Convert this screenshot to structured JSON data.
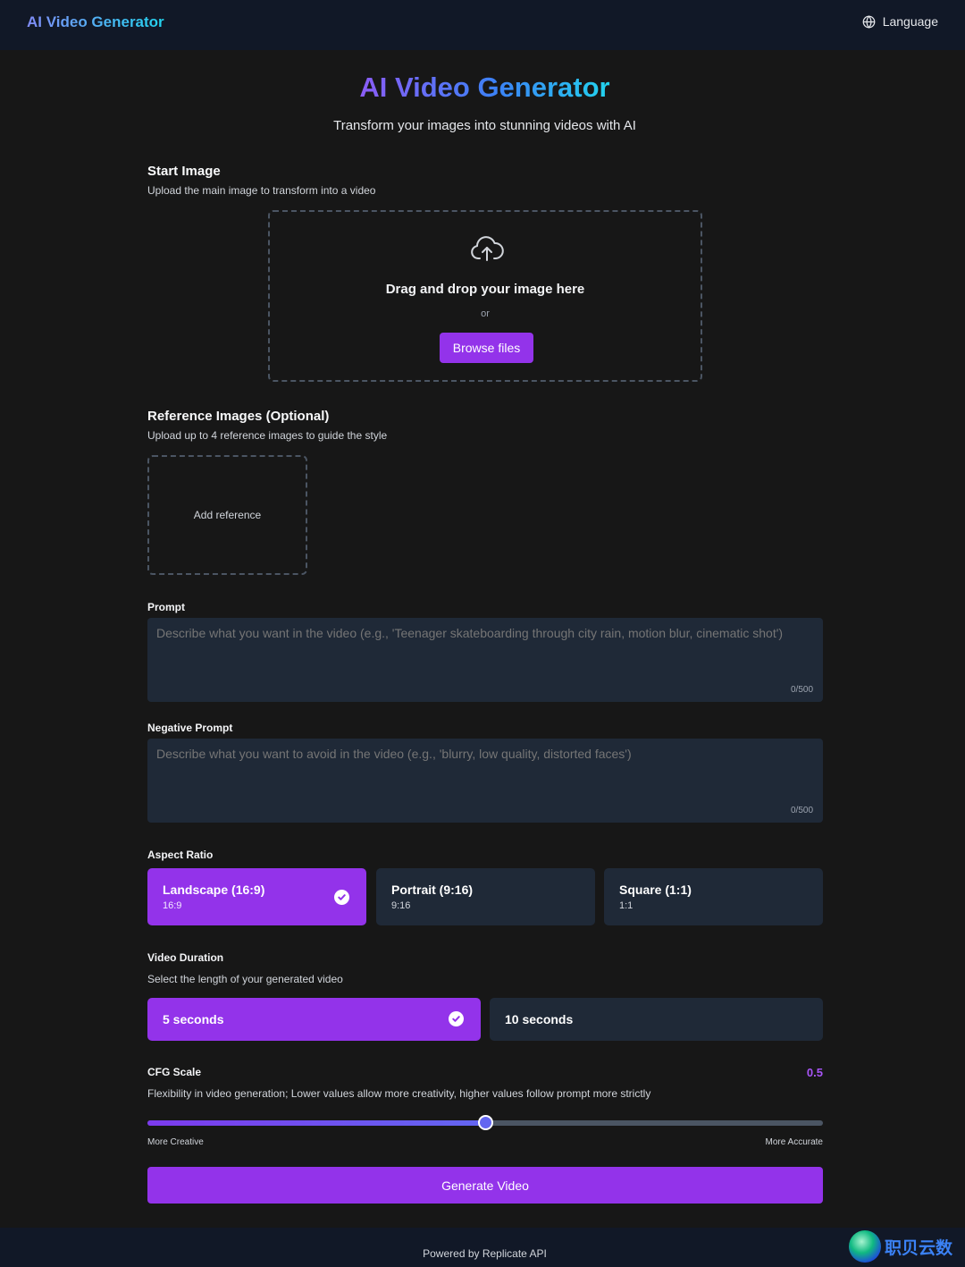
{
  "header": {
    "brand": "AI Video Generator",
    "language_label": "Language"
  },
  "hero": {
    "title": "AI Video Generator",
    "subtitle": "Transform your images into stunning videos with AI"
  },
  "start_image": {
    "title": "Start Image",
    "subtitle": "Upload the main image to transform into a video",
    "drop_text": "Drag and drop your image here",
    "or_text": "or",
    "browse_label": "Browse files"
  },
  "reference": {
    "title": "Reference Images (Optional)",
    "subtitle": "Upload up to 4 reference images to guide the style",
    "add_label": "Add reference"
  },
  "prompt": {
    "label": "Prompt",
    "placeholder": "Describe what you want in the video (e.g., 'Teenager skateboarding through city rain, motion blur, cinematic shot')",
    "counter": "0/500"
  },
  "negative_prompt": {
    "label": "Negative Prompt",
    "placeholder": "Describe what you want to avoid in the video (e.g., 'blurry, low quality, distorted faces')",
    "counter": "0/500"
  },
  "aspect_ratio": {
    "label": "Aspect Ratio",
    "options": [
      {
        "name": "Landscape (16:9)",
        "value": "16:9",
        "selected": true
      },
      {
        "name": "Portrait (9:16)",
        "value": "9:16",
        "selected": false
      },
      {
        "name": "Square (1:1)",
        "value": "1:1",
        "selected": false
      }
    ]
  },
  "duration": {
    "label": "Video Duration",
    "subtitle": "Select the length of your generated video",
    "options": [
      {
        "name": "5 seconds",
        "selected": true
      },
      {
        "name": "10 seconds",
        "selected": false
      }
    ]
  },
  "cfg": {
    "label": "CFG Scale",
    "value": "0.5",
    "level": 0.5,
    "description": "Flexibility in video generation; Lower values allow more creativity, higher values follow prompt more strictly",
    "min_label": "More Creative",
    "max_label": "More Accurate"
  },
  "generate_label": "Generate Video",
  "footer": {
    "text": "Powered by Replicate API"
  },
  "watermark": {
    "text": "职贝云数"
  },
  "colors": {
    "accent": "#9333ea",
    "background": "#171717",
    "panel": "#1f2937",
    "header": "#111827",
    "cfg_value": "#a855f7"
  }
}
